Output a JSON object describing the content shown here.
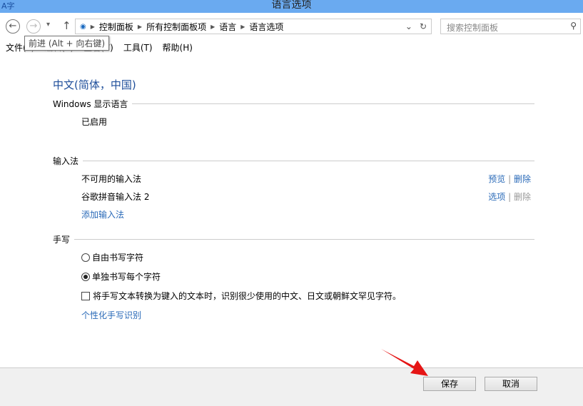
{
  "window": {
    "title": "语言选项",
    "app_icon": "A字"
  },
  "nav": {
    "back": "←",
    "forward": "→",
    "up": "↑",
    "dropdown": "▾",
    "breadcrumb": [
      "控制面板",
      "所有控制面板项",
      "语言",
      "语言选项"
    ],
    "search_placeholder": "搜索控制面板",
    "tooltip": "前进 (Alt + 向右键)"
  },
  "menu": [
    "文件(F)",
    "编辑(E)",
    "查看(V)",
    "工具(T)",
    "帮助(H)"
  ],
  "language": "中文(简体，中国)",
  "display": {
    "header": "Windows 显示语言",
    "status": "已启用"
  },
  "input": {
    "header": "输入法",
    "methods": [
      {
        "name": "不可用的输入法",
        "a": "预览",
        "b": "删除"
      },
      {
        "name": "谷歌拼音输入法 2",
        "a": "选项",
        "b": "删除"
      }
    ],
    "add": "添加输入法"
  },
  "handwriting": {
    "header": "手写",
    "options": [
      "自由书写字符",
      "单独书写每个字符"
    ],
    "selected": 1,
    "checkbox": "将手写文本转换为键入的文本时，识别很少使用的中文、日文或朝鲜文罕见字符。",
    "personalize": "个性化手写识别"
  },
  "buttons": {
    "save": "保存",
    "cancel": "取消"
  }
}
